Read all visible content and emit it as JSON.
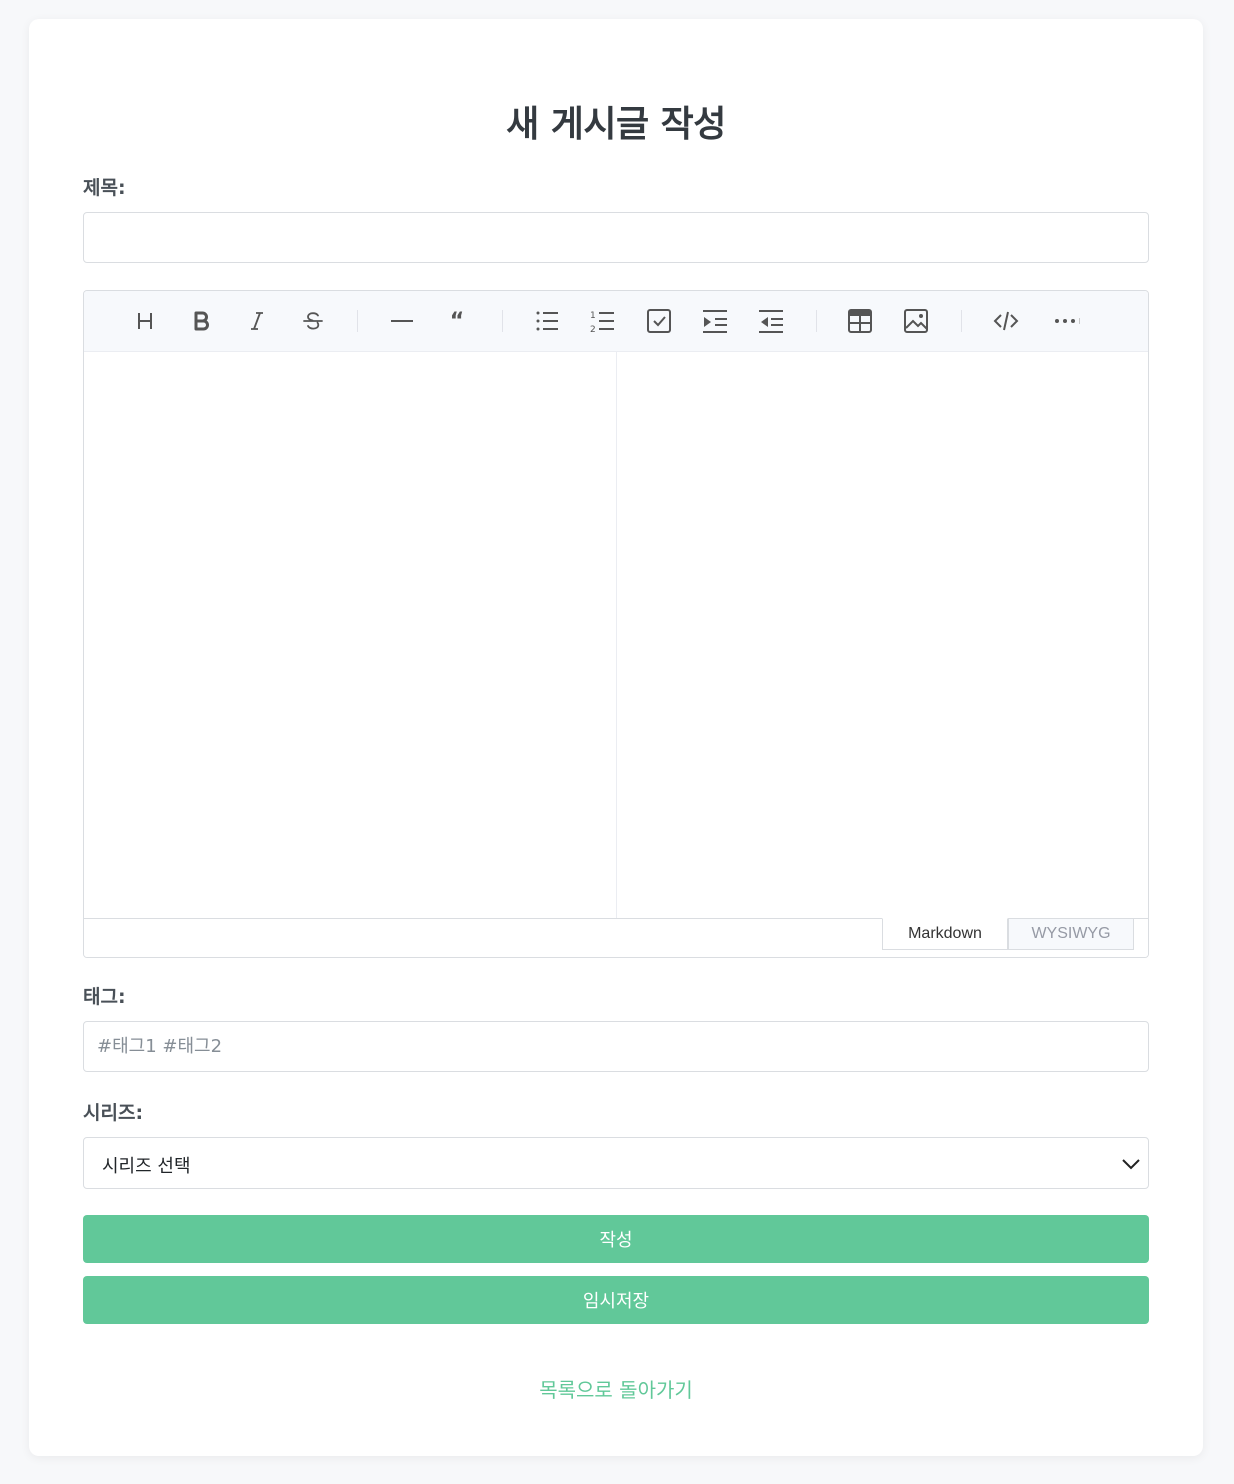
{
  "page": {
    "title": "새 게시글 작성"
  },
  "form": {
    "title_label": "제목:",
    "title_value": "",
    "tags_label": "태그:",
    "tags_placeholder": "#태그1 #태그2",
    "tags_value": "",
    "series_label": "시리즈:",
    "series_selected": "시리즈 선택"
  },
  "editor": {
    "toolbar": [
      "heading-icon",
      "bold-icon",
      "italic-icon",
      "strike-icon",
      "hr-icon",
      "quote-icon",
      "bullet-list-icon",
      "ordered-list-icon",
      "task-list-icon",
      "indent-icon",
      "outdent-icon",
      "table-icon",
      "image-icon",
      "code-block-icon",
      "more-icon"
    ],
    "modes": {
      "markdown": "Markdown",
      "wysiwyg": "WYSIWYG",
      "active": "markdown"
    }
  },
  "actions": {
    "submit_label": "작성",
    "draft_label": "임시저장",
    "back_label": "목록으로 돌아가기"
  },
  "colors": {
    "accent": "#61c899",
    "background": "#f7f8fa",
    "toolbar_bg": "#f7f9fc",
    "border": "#dadde1"
  }
}
